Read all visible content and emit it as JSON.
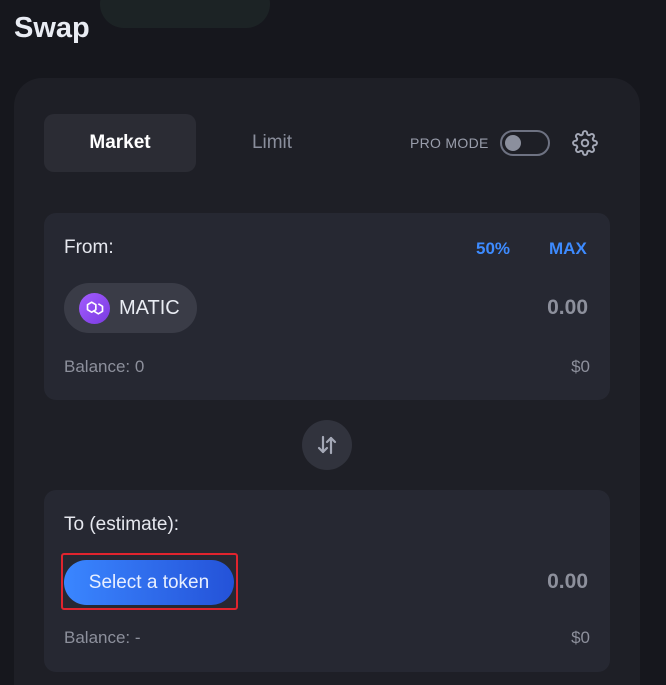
{
  "page": {
    "title": "Swap"
  },
  "tabs": [
    {
      "label": "Market",
      "active": true
    },
    {
      "label": "Limit",
      "active": false
    }
  ],
  "pro_mode": {
    "label": "PRO MODE",
    "enabled": false
  },
  "from": {
    "label": "From:",
    "percent_label": "50%",
    "max_label": "MAX",
    "token": {
      "symbol": "MATIC",
      "icon": "polygon-logo-icon"
    },
    "amount": "0.00",
    "balance": "Balance: 0",
    "usd": "$0"
  },
  "to": {
    "label": "To (estimate):",
    "select_label": "Select a token",
    "amount": "0.00",
    "balance": "Balance: -",
    "usd": "$0"
  },
  "colors": {
    "accent": "#3d8bff",
    "background": "#16171d",
    "card": "#1e1f26",
    "panel": "#262832",
    "highlight": "#e0242e"
  }
}
